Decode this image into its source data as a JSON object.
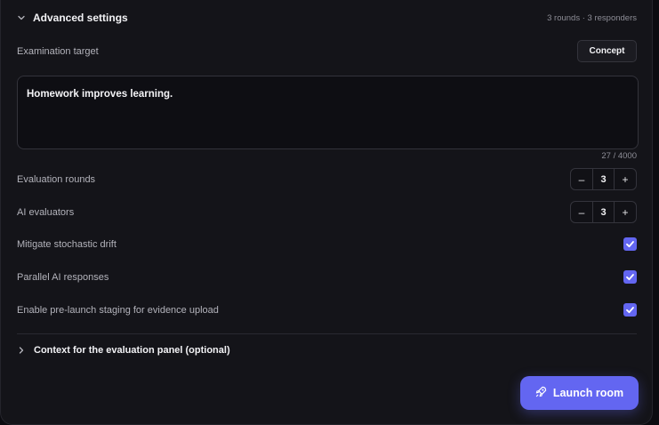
{
  "header": {
    "title": "Advanced settings",
    "summary": "3 rounds · 3 responders",
    "chevron_icon": "chevron-down-icon"
  },
  "examination": {
    "label": "Examination target",
    "selected": "Concept"
  },
  "prompt": {
    "value": "Homework improves learning.",
    "counter": "27 / 4000"
  },
  "evaluation_rounds": {
    "label": "Evaluation rounds",
    "value": "3",
    "minus": "–",
    "plus": "+"
  },
  "ai_evaluators": {
    "label": "AI evaluators",
    "value": "3",
    "minus": "–",
    "plus": "+"
  },
  "options": [
    {
      "label": "Mitigate stochastic drift",
      "checked": true
    },
    {
      "label": "Parallel AI responses",
      "checked": true
    },
    {
      "label": "Enable pre-launch staging for evidence upload",
      "checked": true
    }
  ],
  "context": {
    "label": "Context for the evaluation panel (optional)",
    "icon": "chevron-right-icon"
  },
  "launch": {
    "label": "Launch room",
    "icon": "rocket-icon"
  },
  "colors": {
    "accent": "#6366f1",
    "panel_bg": "#141419",
    "text_muted": "#b3b3bb"
  }
}
